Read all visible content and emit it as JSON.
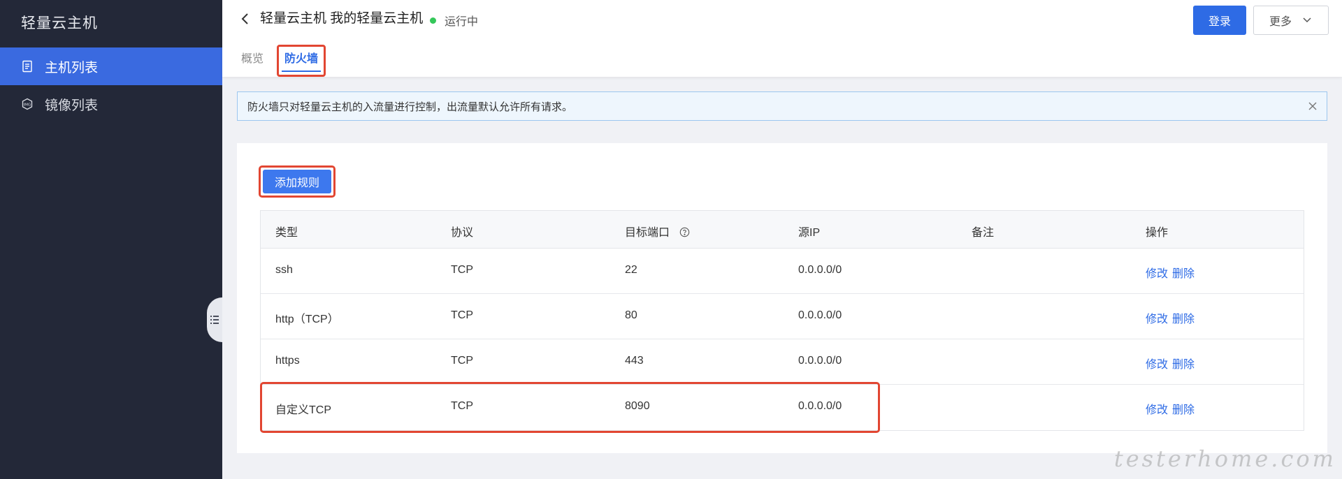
{
  "sidebar": {
    "title": "轻量云主机",
    "items": [
      {
        "label": "主机列表",
        "icon": "document-list-icon",
        "active": true
      },
      {
        "label": "镜像列表",
        "icon": "image-hexagon-icon",
        "active": false
      }
    ]
  },
  "header": {
    "title": "轻量云主机 我的轻量云主机",
    "status": "运行中",
    "status_color": "#34c759",
    "tabs": [
      {
        "label": "概览",
        "active": false
      },
      {
        "label": "防火墙",
        "active": true
      }
    ],
    "login_label": "登录",
    "more_label": "更多"
  },
  "alert": {
    "text": "防火墙只对轻量云主机的入流量进行控制，出流量默认允许所有请求。"
  },
  "firewall": {
    "add_rule_label": "添加规则",
    "columns": [
      "类型",
      "协议",
      "目标端口",
      "源IP",
      "备注",
      "操作"
    ],
    "rows": [
      {
        "type": "ssh",
        "protocol": "TCP",
        "port": "22",
        "source_ip": "0.0.0.0/0",
        "note": "",
        "actions": [
          "修改",
          "删除"
        ]
      },
      {
        "type": "http（TCP）",
        "protocol": "TCP",
        "port": "80",
        "source_ip": "0.0.0.0/0",
        "note": "",
        "actions": [
          "修改",
          "删除"
        ]
      },
      {
        "type": "https",
        "protocol": "TCP",
        "port": "443",
        "source_ip": "0.0.0.0/0",
        "note": "",
        "actions": [
          "修改",
          "删除"
        ]
      },
      {
        "type": "自定义TCP",
        "protocol": "TCP",
        "port": "8090",
        "source_ip": "0.0.0.0/0",
        "note": "",
        "actions": [
          "修改",
          "删除"
        ]
      }
    ]
  },
  "watermark": "testerhome.com",
  "colors": {
    "sidebar_bg": "#232838",
    "accent": "#2e6be5",
    "highlight": "#e24632"
  }
}
